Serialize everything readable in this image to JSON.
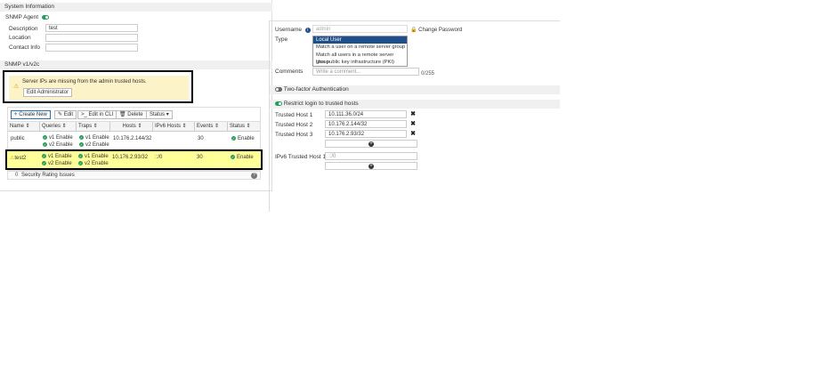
{
  "left": {
    "system_information": "System Information",
    "snmp_agent_label": "SNMP Agent",
    "description_label": "Description",
    "description_value": "test",
    "location_label": "Location",
    "contact_label": "Contact Info",
    "snmp_v1v2c": "SNMP v1/v2c",
    "warning_text": "Server IPs are missing from the admin trusted hosts.",
    "edit_admin_label": "Edit Administrator",
    "toolbar": {
      "create_new": "Create New",
      "edit": "Edit",
      "edit_cli": "Edit in CLI",
      "delete": "Delete",
      "status": "Status"
    },
    "columns": [
      "Name",
      "Queries",
      "Traps",
      "Hosts",
      "IPv6 Hosts",
      "Events",
      "Status"
    ],
    "rows": [
      {
        "name": "public",
        "q1": "v1 Enable",
        "q2": "v2 Enable",
        "t1": "v1 Enable",
        "t2": "v2 Enable",
        "hosts": "10.176.2.144/32",
        "ipv6": "",
        "events": "30",
        "status": "Enable"
      },
      {
        "name": "test2",
        "q1": "v1 Enable",
        "q2": "v2 Enable",
        "t1": "v1 Enable",
        "t2": "v2 Enable",
        "hosts": "10.176.2.93/32",
        "ipv6": "::/0",
        "events": "30",
        "status": "Enable"
      }
    ],
    "security_count": "0",
    "security_label": "Security Rating Issues"
  },
  "right": {
    "username_label": "Username",
    "username_value": "admin",
    "change_password": "Change Password",
    "type_label": "Type",
    "type_options": [
      "Local User",
      "Match a user on a remote server group",
      "Match all users in a remote server group",
      "Use public key infrastructure (PKI) group"
    ],
    "comments_label": "Comments",
    "comments_placeholder": "Write a comment...",
    "comments_count": "0/255",
    "two_factor": "Two-factor Authentication",
    "restrict_login": "Restrict login to trusted hosts",
    "trusted_hosts": [
      {
        "label": "Trusted Host 1",
        "value": "10.111.36.0/24"
      },
      {
        "label": "Trusted Host 2",
        "value": "10.176.2.144/32"
      },
      {
        "label": "Trusted Host 3",
        "value": "10.176.2.93/32"
      }
    ],
    "ipv6_host_label": "IPv6 Trusted Host 1",
    "ipv6_host_placeholder": "::/0"
  },
  "colors": {
    "enable_green": "#2a9d5c",
    "warning_bg": "#fdf3c8",
    "highlight_row": "#ffff99",
    "selected_option": "#1f4e8c",
    "callout_border": "#000000"
  }
}
